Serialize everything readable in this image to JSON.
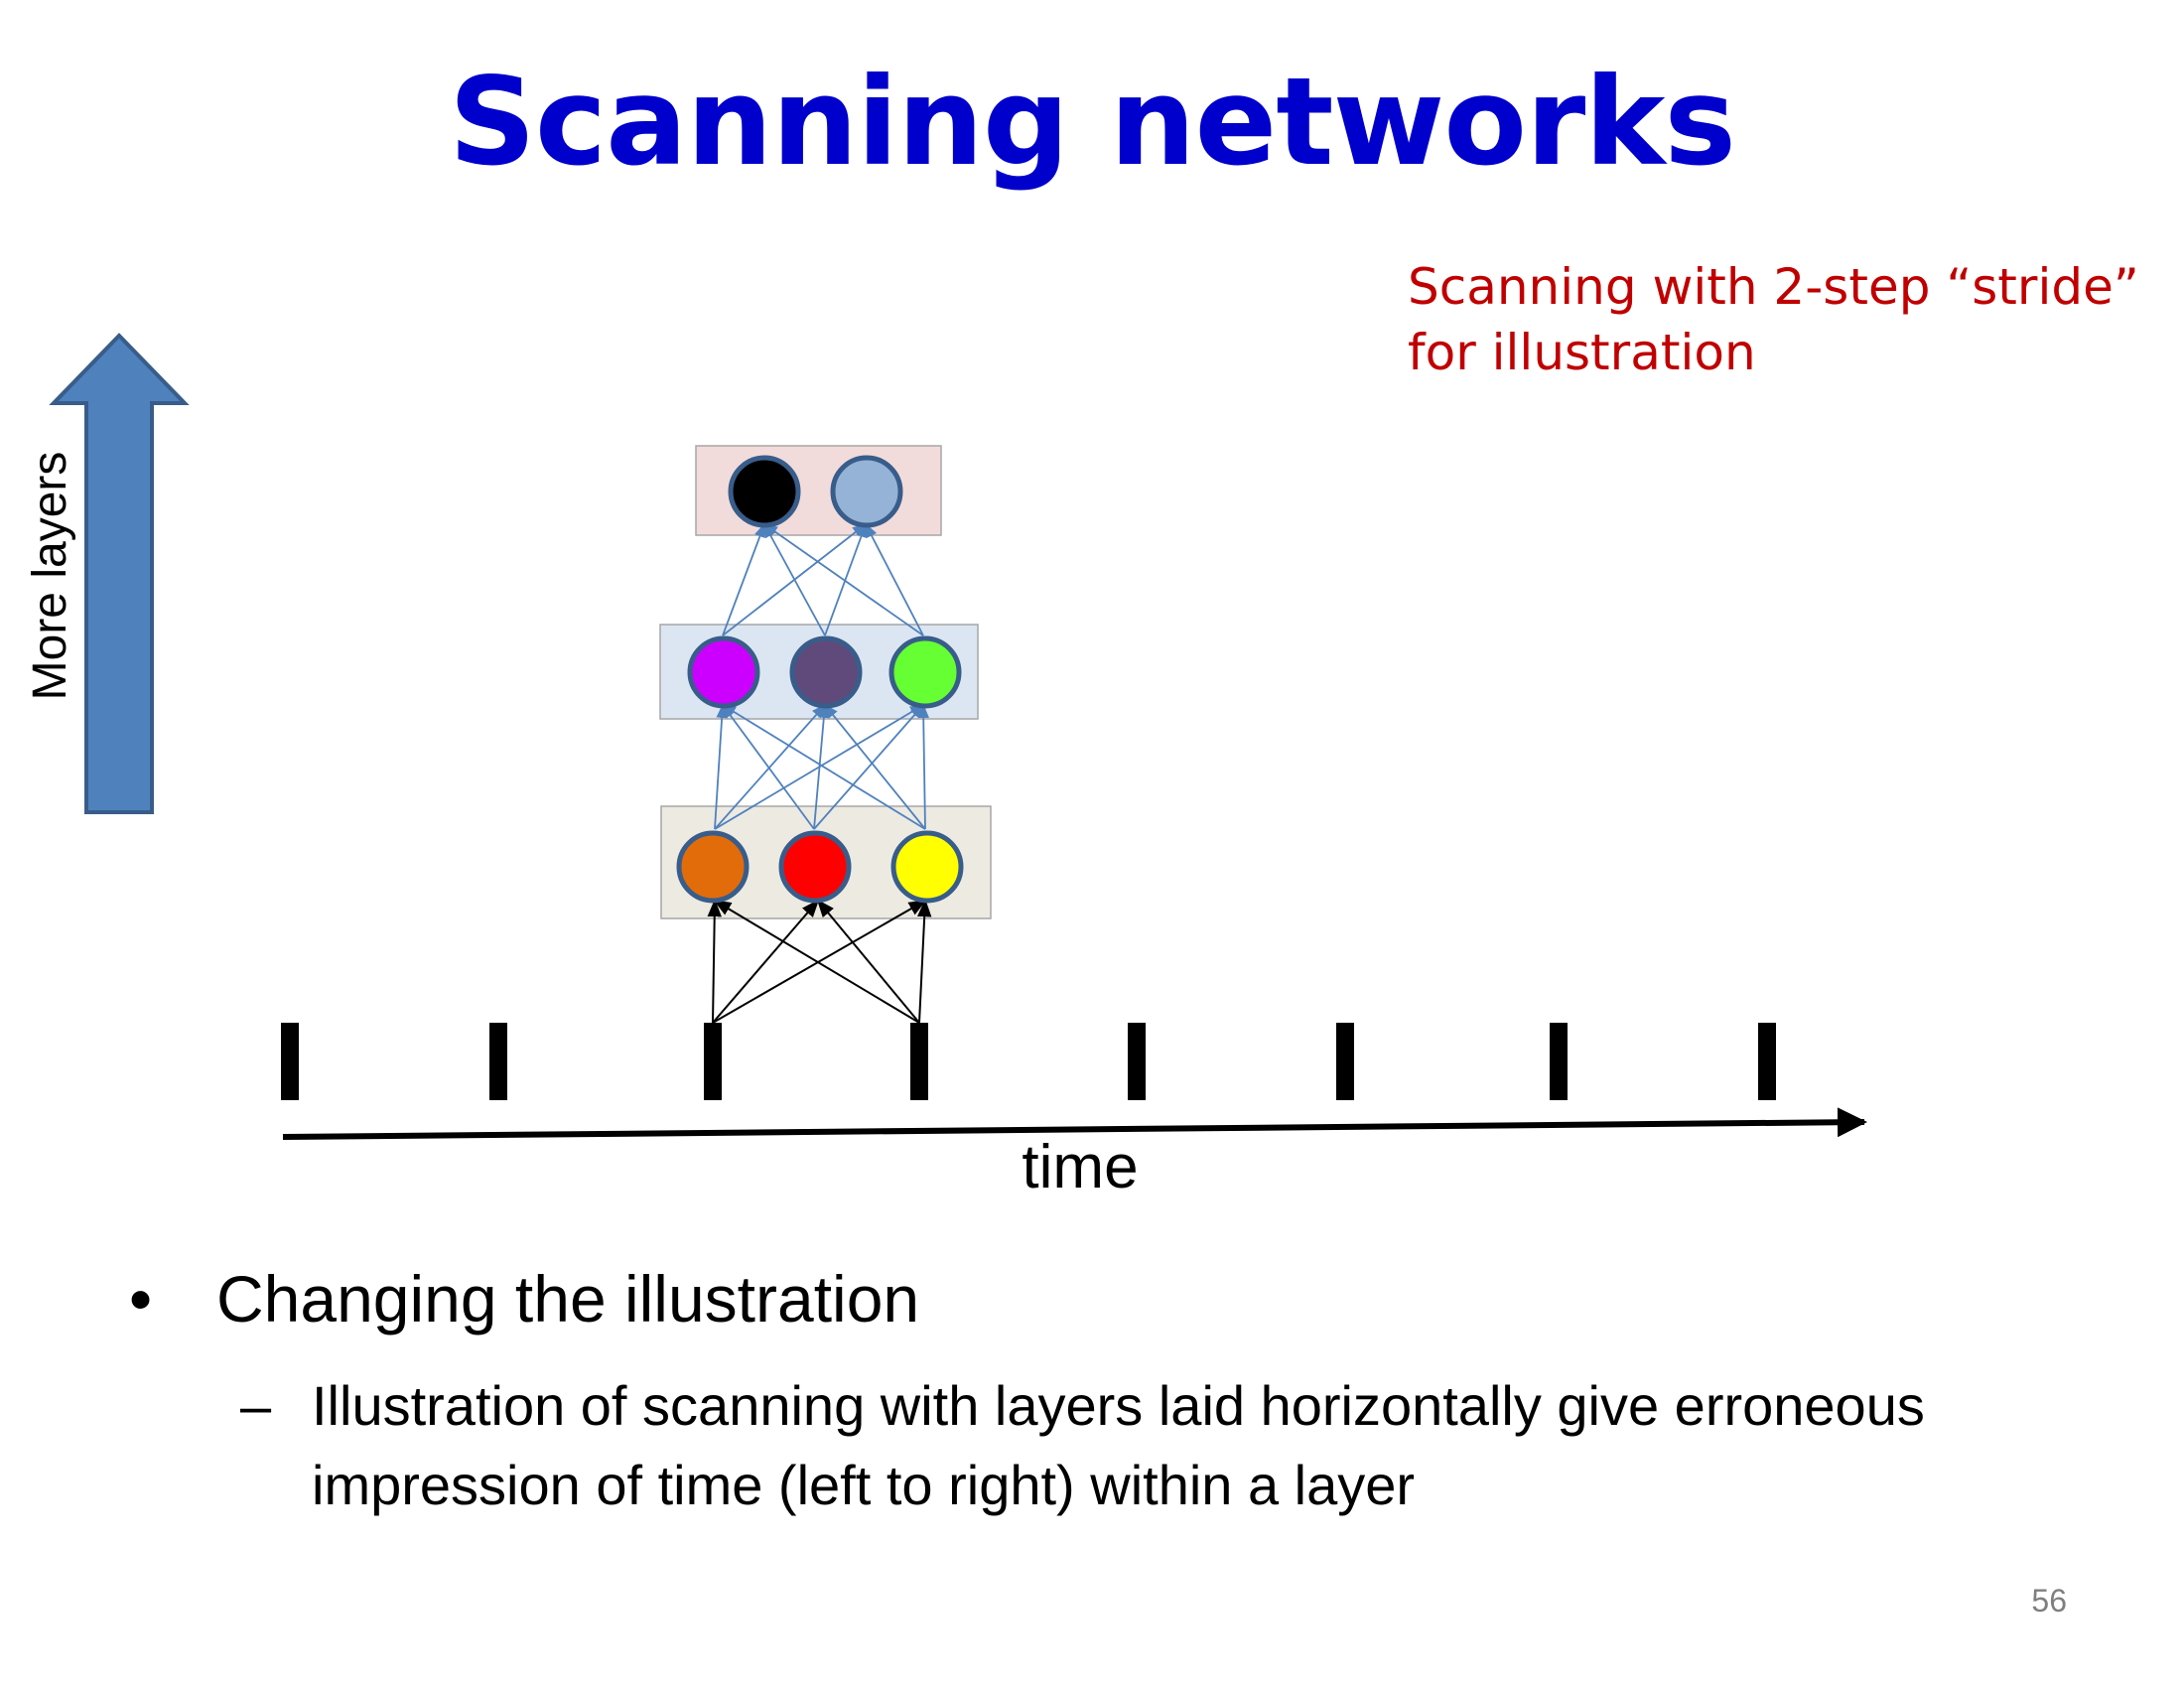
{
  "slide": {
    "title": "Scanning networks",
    "note_line1": "Scanning with 2-step “stride”",
    "note_line2": "for illustration",
    "up_arrow_label": "More layers",
    "axis_label": "time",
    "bullet_marker": "•",
    "bullet": "Changing the illustration",
    "sub_marker": "–",
    "sub_bullet": "Illustration of scanning with layers laid horizontally give erroneous impression of time (left to right) within a layer",
    "page_number": "56"
  },
  "diagram": {
    "input_tick_count": 8,
    "connected_inputs": [
      3,
      4
    ],
    "layers": [
      {
        "name": "layer-1",
        "box_color": "#edeae2",
        "node_colors": [
          "#e36c0a",
          "#ff0000",
          "#ffff00"
        ]
      },
      {
        "name": "layer-2",
        "box_color": "#dce6f2",
        "node_colors": [
          "#cc00ff",
          "#604a7b",
          "#66ff33"
        ]
      },
      {
        "name": "layer-3",
        "box_color": "#f2dcdb",
        "node_colors": [
          "#000000",
          "#95b3d7"
        ]
      }
    ],
    "colors": {
      "title": "#0000cc",
      "note": "#c00000",
      "node_border": "#385d8a",
      "hidden_connections": "#4f81bd",
      "input_connections": "#000000",
      "up_arrow_fill": "#4f81bd",
      "up_arrow_border": "#385d8a"
    }
  }
}
